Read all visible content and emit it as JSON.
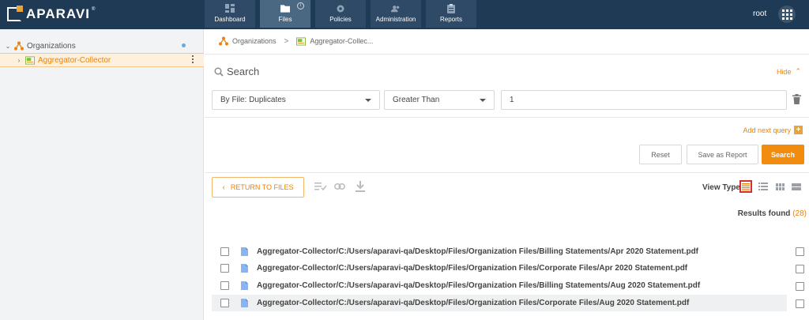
{
  "app": {
    "brand": "APARAVI",
    "brand_mark": "®",
    "user": "root"
  },
  "nav": {
    "tabs": [
      {
        "label": "Dashboard",
        "icon": "dashboard-icon"
      },
      {
        "label": "Files",
        "icon": "folder-icon",
        "active": true,
        "info": "i"
      },
      {
        "label": "Policies",
        "icon": "gear-icon"
      },
      {
        "label": "Administration",
        "icon": "users-icon"
      },
      {
        "label": "Reports",
        "icon": "clipboard-icon"
      }
    ]
  },
  "sidebar": {
    "items": [
      {
        "label": "Organizations",
        "caret": "⌄"
      },
      {
        "label": "Aggregator-Collector",
        "caret": "›"
      }
    ]
  },
  "breadcrumb": {
    "items": [
      "Organizations",
      "Aggregator-Collec..."
    ],
    "separator": ">"
  },
  "search": {
    "title": "Search",
    "hide_label": "Hide",
    "field_select": "By File: Duplicates",
    "operator_select": "Greater Than",
    "value": "1",
    "add_query_label": "Add next query",
    "add_query_plus": "+",
    "reset_label": "Reset",
    "save_report_label": "Save as Report",
    "search_label": "Search"
  },
  "toolbar": {
    "return_label": "RETURN TO FILES",
    "return_chevron": "‹",
    "view_type_label": "View Type"
  },
  "results": {
    "label": "Results found",
    "count": "(28)",
    "rows": [
      "Aggregator-Collector/C:/Users/aparavi-qa/Desktop/Files/Organization Files/Billing Statements/Apr 2020 Statement.pdf",
      "Aggregator-Collector/C:/Users/aparavi-qa/Desktop/Files/Organization Files/Corporate Files/Apr 2020 Statement.pdf",
      "Aggregator-Collector/C:/Users/aparavi-qa/Desktop/Files/Organization Files/Billing Statements/Aug 2020 Statement.pdf",
      "Aggregator-Collector/C:/Users/aparavi-qa/Desktop/Files/Organization Files/Corporate Files/Aug 2020 Statement.pdf"
    ]
  },
  "colors": {
    "topbar": "#1f3a55",
    "accent": "#f28c0f",
    "selected_border": "#d63030"
  }
}
